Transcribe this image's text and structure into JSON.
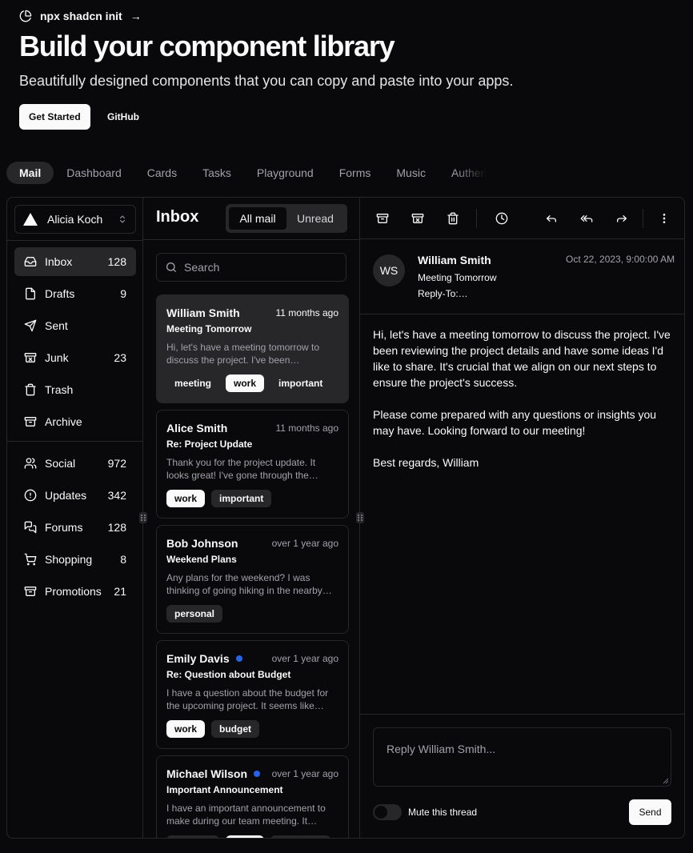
{
  "hero": {
    "announce_text": "npx shadcn init",
    "announce_arrow": "→",
    "title": "Build your component library",
    "subtitle": "Beautifully designed components that you can copy and paste into your apps.",
    "cta_primary": "Get Started",
    "cta_secondary": "GitHub"
  },
  "example_tabs": [
    "Mail",
    "Dashboard",
    "Cards",
    "Tasks",
    "Playground",
    "Forms",
    "Music",
    "Authentication"
  ],
  "active_tab": "Mail",
  "account": {
    "name": "Alicia Koch"
  },
  "nav_primary": [
    {
      "label": "Inbox",
      "count": "128",
      "icon": "inbox-icon",
      "active": true
    },
    {
      "label": "Drafts",
      "count": "9",
      "icon": "file-icon"
    },
    {
      "label": "Sent",
      "count": "",
      "icon": "send-icon"
    },
    {
      "label": "Junk",
      "count": "23",
      "icon": "archive-x-icon"
    },
    {
      "label": "Trash",
      "count": "",
      "icon": "trash-icon"
    },
    {
      "label": "Archive",
      "count": "",
      "icon": "archive-icon"
    }
  ],
  "nav_secondary": [
    {
      "label": "Social",
      "count": "972",
      "icon": "users-icon"
    },
    {
      "label": "Updates",
      "count": "342",
      "icon": "alert-circle-icon"
    },
    {
      "label": "Forums",
      "count": "128",
      "icon": "messages-icon"
    },
    {
      "label": "Shopping",
      "count": "8",
      "icon": "cart-icon"
    },
    {
      "label": "Promotions",
      "count": "21",
      "icon": "archive-icon"
    }
  ],
  "inbox": {
    "title": "Inbox",
    "filter_all": "All mail",
    "filter_unread": "Unread",
    "search_placeholder": "Search"
  },
  "mails": [
    {
      "name": "William Smith",
      "date": "11 months ago",
      "unread": false,
      "subject": "Meeting Tomorrow",
      "preview": "Hi, let's have a meeting tomorrow to discuss the project. I've been…",
      "tags": [
        {
          "label": "meeting",
          "primary": false
        },
        {
          "label": "work",
          "primary": true
        },
        {
          "label": "important",
          "primary": false
        }
      ],
      "selected": true
    },
    {
      "name": "Alice Smith",
      "date": "11 months ago",
      "unread": false,
      "subject": "Re: Project Update",
      "preview": "Thank you for the project update. It looks great! I've gone through the…",
      "tags": [
        {
          "label": "work",
          "primary": true
        },
        {
          "label": "important",
          "primary": false
        }
      ]
    },
    {
      "name": "Bob Johnson",
      "date": "over 1 year ago",
      "unread": false,
      "subject": "Weekend Plans",
      "preview": "Any plans for the weekend? I was thinking of going hiking in the nearby…",
      "tags": [
        {
          "label": "personal",
          "primary": false
        }
      ]
    },
    {
      "name": "Emily Davis",
      "date": "over 1 year ago",
      "unread": true,
      "subject": "Re: Question about Budget",
      "preview": "I have a question about the budget for the upcoming project. It seems like…",
      "tags": [
        {
          "label": "work",
          "primary": true
        },
        {
          "label": "budget",
          "primary": false
        }
      ]
    },
    {
      "name": "Michael Wilson",
      "date": "over 1 year ago",
      "unread": true,
      "subject": "Important Announcement",
      "preview": "I have an important announcement to make during our team meeting. It…",
      "tags": [
        {
          "label": "meeting",
          "primary": false
        },
        {
          "label": "work",
          "primary": true
        },
        {
          "label": "important",
          "primary": false
        }
      ]
    }
  ],
  "message": {
    "initials": "WS",
    "sender": "William Smith",
    "subject": "Meeting Tomorrow",
    "reply_to": "Reply-To:…",
    "date": "Oct 22, 2023, 9:00:00 AM",
    "body": [
      "Hi, let's have a meeting tomorrow to discuss the project. I've been reviewing the project details and have some ideas I'd like to share. It's crucial that we align on our next steps to ensure the project's success.",
      "Please come prepared with any questions or insights you may have. Looking forward to our meeting!",
      "Best regards, William"
    ],
    "reply_placeholder": "Reply William Smith...",
    "mute_label": "Mute this thread",
    "mute_on": false,
    "send_label": "Send"
  },
  "colors": {
    "background": "#09090b",
    "muted": "#27272a",
    "foreground": "#fafafa",
    "muted_foreground": "#a1a1aa",
    "unread_dot": "#2563eb"
  }
}
